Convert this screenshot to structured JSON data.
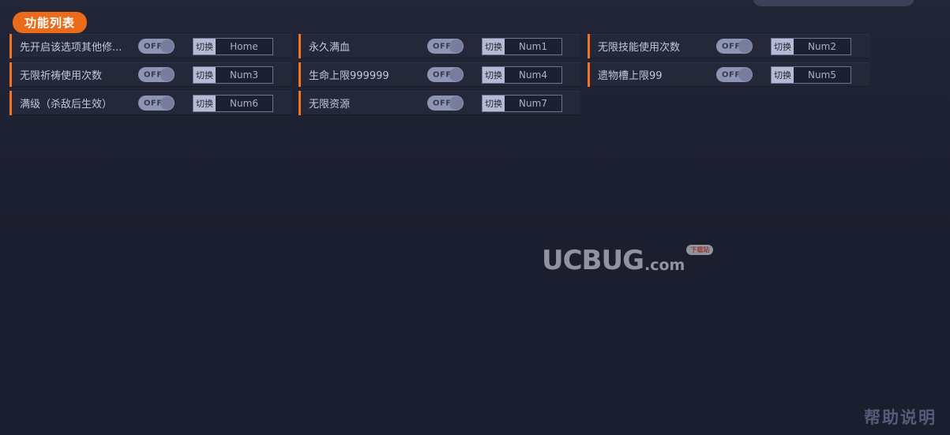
{
  "window": {
    "background_color": "#1b1e2e",
    "accent_color": "#ec6b1a"
  },
  "section_tab": {
    "label": "功能列表"
  },
  "toggle": {
    "off_label": "OFF"
  },
  "hotkey": {
    "action_label": "切换"
  },
  "columns": [
    {
      "rows": [
        {
          "label": "先开启该选项其他修...",
          "state": "OFF",
          "action": "切换",
          "key": "Home"
        },
        {
          "label": "无限祈祷使用次数",
          "state": "OFF",
          "action": "切换",
          "key": "Num3"
        },
        {
          "label": "满级（杀敌后生效）",
          "state": "OFF",
          "action": "切换",
          "key": "Num6"
        }
      ]
    },
    {
      "rows": [
        {
          "label": "永久满血",
          "state": "OFF",
          "action": "切换",
          "key": "Num1"
        },
        {
          "label": "生命上限999999",
          "state": "OFF",
          "action": "切换",
          "key": "Num4"
        },
        {
          "label": "无限资源",
          "state": "OFF",
          "action": "切换",
          "key": "Num7"
        }
      ]
    },
    {
      "rows": [
        {
          "label": "无限技能使用次数",
          "state": "OFF",
          "action": "切换",
          "key": "Num2"
        },
        {
          "label": "遗物槽上限99",
          "state": "OFF",
          "action": "切换",
          "key": "Num5"
        }
      ]
    }
  ],
  "watermark": {
    "mark": "UCBUG",
    "domain": ".com",
    "badge": "下载站"
  },
  "footer": {
    "help_label": "帮助说明"
  }
}
